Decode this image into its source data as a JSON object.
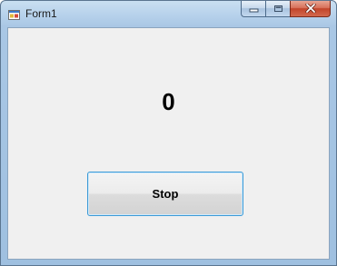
{
  "window": {
    "title": "Form1",
    "controls": {
      "minimize_icon": "minimize-icon",
      "maximize_icon": "maximize-icon",
      "close_icon": "close-icon"
    }
  },
  "main": {
    "counter_value": "0",
    "stop_button_label": "Stop"
  },
  "colors": {
    "client_background": "#f0f0f0",
    "button_border": "#3c9ad6",
    "close_button": "#c94a30"
  }
}
